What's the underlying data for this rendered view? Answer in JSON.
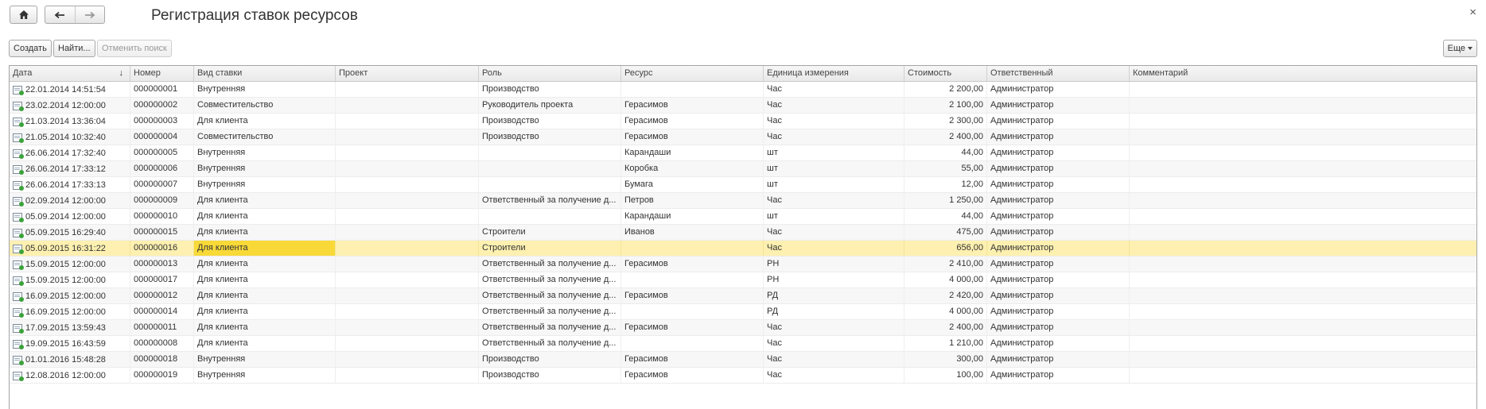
{
  "window": {
    "title": "Регистрация ставок ресурсов",
    "close": "×",
    "back": "←",
    "forward": "→"
  },
  "toolbar": {
    "create": "Создать",
    "find": "Найти...",
    "cancel_search": "Отменить поиск",
    "more": "Еще"
  },
  "columns": {
    "date": "Дата",
    "number": "Номер",
    "kind": "Вид ставки",
    "project": "Проект",
    "role": "Роль",
    "resource": "Ресурс",
    "unit": "Единица измерения",
    "cost": "Стоимость",
    "responsible": "Ответственный",
    "comment": "Комментарий",
    "sort_indicator": "↓"
  },
  "selected_row_index": 10,
  "rows": [
    {
      "date": "22.01.2014 14:51:54",
      "number": "000000001",
      "kind": "Внутренняя",
      "project": "",
      "role": "Производство",
      "resource": "",
      "unit": "Час",
      "cost": "2 200,00",
      "responsible": "Администратор",
      "comment": ""
    },
    {
      "date": "23.02.2014 12:00:00",
      "number": "000000002",
      "kind": "Совместительство",
      "project": "",
      "role": "Руководитель проекта",
      "resource": "Герасимов",
      "unit": "Час",
      "cost": "2 100,00",
      "responsible": "Администратор",
      "comment": ""
    },
    {
      "date": "21.03.2014 13:36:04",
      "number": "000000003",
      "kind": "Для клиента",
      "project": "",
      "role": "Производство",
      "resource": "Герасимов",
      "unit": "Час",
      "cost": "2 300,00",
      "responsible": "Администратор",
      "comment": ""
    },
    {
      "date": "21.05.2014 10:32:40",
      "number": "000000004",
      "kind": "Совместительство",
      "project": "",
      "role": "Производство",
      "resource": "Герасимов",
      "unit": "Час",
      "cost": "2 400,00",
      "responsible": "Администратор",
      "comment": ""
    },
    {
      "date": "26.06.2014 17:32:40",
      "number": "000000005",
      "kind": "Внутренняя",
      "project": "",
      "role": "",
      "resource": "Карандаши",
      "unit": "шт",
      "cost": "44,00",
      "responsible": "Администратор",
      "comment": ""
    },
    {
      "date": "26.06.2014 17:33:12",
      "number": "000000006",
      "kind": "Внутренняя",
      "project": "",
      "role": "",
      "resource": "Коробка",
      "unit": "шт",
      "cost": "55,00",
      "responsible": "Администратор",
      "comment": ""
    },
    {
      "date": "26.06.2014 17:33:13",
      "number": "000000007",
      "kind": "Внутренняя",
      "project": "",
      "role": "",
      "resource": "Бумага",
      "unit": "шт",
      "cost": "12,00",
      "responsible": "Администратор",
      "comment": ""
    },
    {
      "date": "02.09.2014 12:00:00",
      "number": "000000009",
      "kind": "Для клиента",
      "project": "",
      "role": "Ответственный за получение д...",
      "resource": "Петров",
      "unit": "Час",
      "cost": "1 250,00",
      "responsible": "Администратор",
      "comment": ""
    },
    {
      "date": "05.09.2014 12:00:00",
      "number": "000000010",
      "kind": "Для клиента",
      "project": "",
      "role": "",
      "resource": "Карандаши",
      "unit": "шт",
      "cost": "44,00",
      "responsible": "Администратор",
      "comment": ""
    },
    {
      "date": "05.09.2015 16:29:40",
      "number": "000000015",
      "kind": "Для клиента",
      "project": "",
      "role": "Строители",
      "resource": "Иванов",
      "unit": "Час",
      "cost": "475,00",
      "responsible": "Администратор",
      "comment": ""
    },
    {
      "date": "05.09.2015 16:31:22",
      "number": "000000016",
      "kind": "Для клиента",
      "project": "",
      "role": "Строители",
      "resource": "",
      "unit": "Час",
      "cost": "656,00",
      "responsible": "Администратор",
      "comment": ""
    },
    {
      "date": "15.09.2015 12:00:00",
      "number": "000000013",
      "kind": "Для клиента",
      "project": "",
      "role": "Ответственный за получение д...",
      "resource": "Герасимов",
      "unit": "РН",
      "cost": "2 410,00",
      "responsible": "Администратор",
      "comment": ""
    },
    {
      "date": "15.09.2015 12:00:00",
      "number": "000000017",
      "kind": "Для клиента",
      "project": "",
      "role": "Ответственный за получение д...",
      "resource": "",
      "unit": "РН",
      "cost": "4 000,00",
      "responsible": "Администратор",
      "comment": ""
    },
    {
      "date": "16.09.2015 12:00:00",
      "number": "000000012",
      "kind": "Для клиента",
      "project": "",
      "role": "Ответственный за получение д...",
      "resource": "Герасимов",
      "unit": "РД",
      "cost": "2 420,00",
      "responsible": "Администратор",
      "comment": ""
    },
    {
      "date": "16.09.2015 12:00:00",
      "number": "000000014",
      "kind": "Для клиента",
      "project": "",
      "role": "Ответственный за получение д...",
      "resource": "",
      "unit": "РД",
      "cost": "4 000,00",
      "responsible": "Администратор",
      "comment": ""
    },
    {
      "date": "17.09.2015 13:59:43",
      "number": "000000011",
      "kind": "Для клиента",
      "project": "",
      "role": "Ответственный за получение д...",
      "resource": "Герасимов",
      "unit": "Час",
      "cost": "2 400,00",
      "responsible": "Администратор",
      "comment": ""
    },
    {
      "date": "19.09.2015 16:43:59",
      "number": "000000008",
      "kind": "Для клиента",
      "project": "",
      "role": "Ответственный за получение д...",
      "resource": "",
      "unit": "Час",
      "cost": "1 210,00",
      "responsible": "Администратор",
      "comment": ""
    },
    {
      "date": "01.01.2016 15:48:28",
      "number": "000000018",
      "kind": "Внутренняя",
      "project": "",
      "role": "Производство",
      "resource": "Герасимов",
      "unit": "Час",
      "cost": "300,00",
      "responsible": "Администратор",
      "comment": ""
    },
    {
      "date": "12.08.2016 12:00:00",
      "number": "000000019",
      "kind": "Внутренняя",
      "project": "",
      "role": "Производство",
      "resource": "Герасимов",
      "unit": "Час",
      "cost": "100,00",
      "responsible": "Администратор",
      "comment": ""
    }
  ]
}
